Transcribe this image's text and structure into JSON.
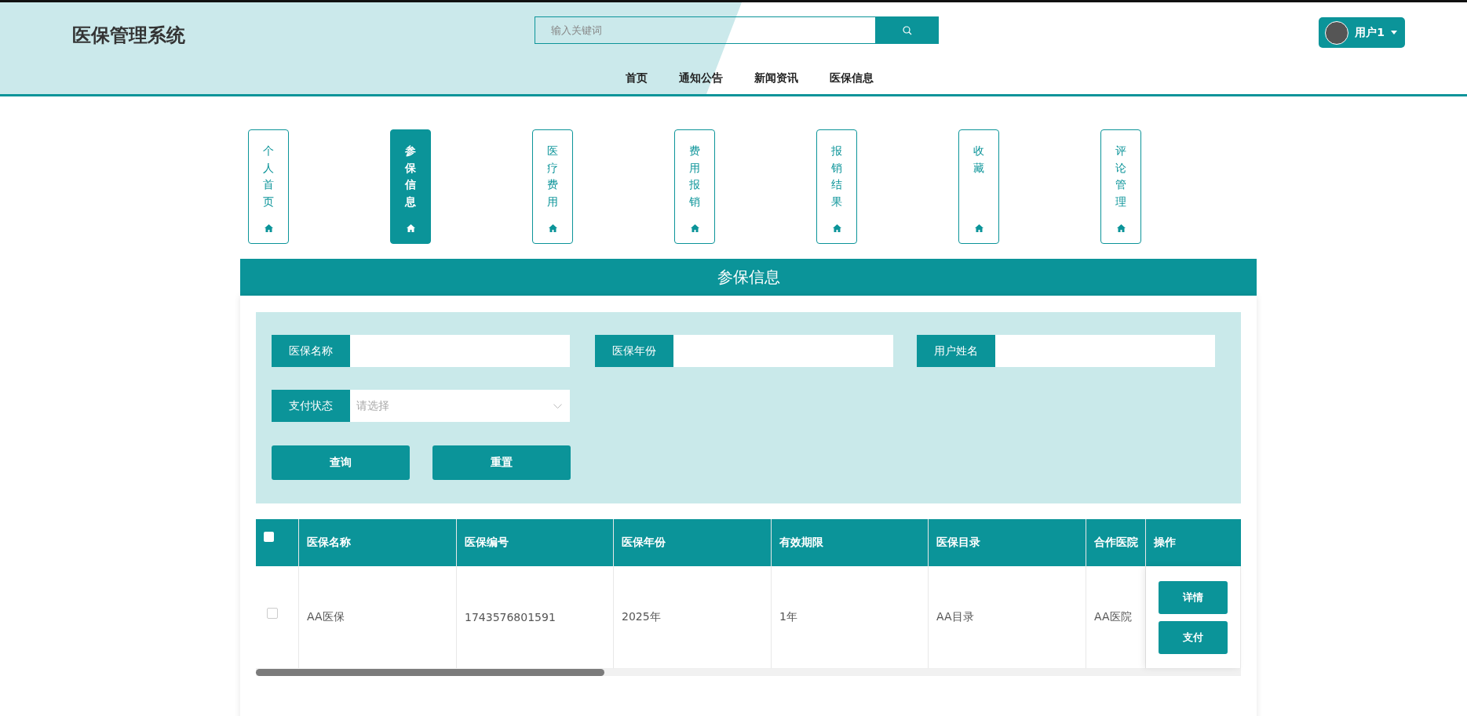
{
  "header": {
    "title": "医保管理系统",
    "search": {
      "placeholder": "输入关键词"
    },
    "user": {
      "label": "用户1"
    }
  },
  "nav": [
    {
      "label": "首页"
    },
    {
      "label": "通知公告"
    },
    {
      "label": "新闻资讯"
    },
    {
      "label": "医保信息"
    }
  ],
  "tabs": [
    {
      "label": "个人首页",
      "selected": false
    },
    {
      "label": "参保信息",
      "selected": true
    },
    {
      "label": "医疗费用",
      "selected": false
    },
    {
      "label": "费用报销",
      "selected": false
    },
    {
      "label": "报销结果",
      "selected": false
    },
    {
      "label": "收藏",
      "selected": false
    },
    {
      "label": "评论管理",
      "selected": false
    }
  ],
  "section_title": "参保信息",
  "filters": [
    {
      "label": "医保名称",
      "kind": "text"
    },
    {
      "label": "医保年份",
      "kind": "text"
    },
    {
      "label": "用户姓名",
      "kind": "text"
    },
    {
      "label": "支付状态",
      "kind": "select",
      "placeholder": "请选择"
    }
  ],
  "filter_buttons": [
    "查询",
    "重置"
  ],
  "table": {
    "select_all": {
      "checked": false
    },
    "columns": [
      "医保名称",
      "医保编号",
      "医保年份",
      "有效期限",
      "医保目录",
      "合作医院"
    ],
    "action_column": "操作",
    "rows": [
      {
        "checked": false,
        "cells": [
          "AA医保",
          "1743576801591",
          "2025年",
          "1年",
          "AA目录",
          "AA医院"
        ],
        "actions": [
          "详情",
          "支付"
        ]
      }
    ]
  }
}
